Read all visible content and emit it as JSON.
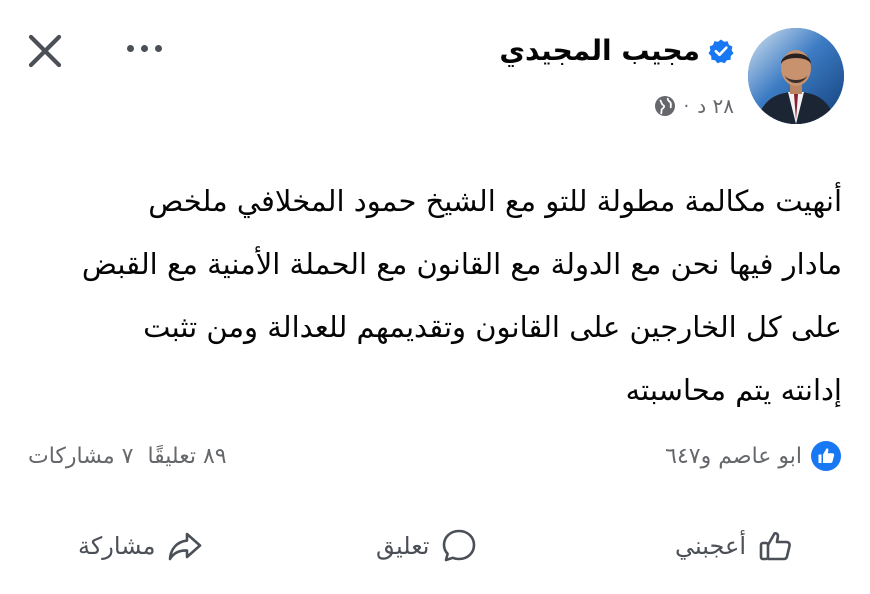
{
  "post": {
    "author_name": "مجيب المجيدي",
    "time": "٢٨ د",
    "separator": "·",
    "lines": [
      "أنهيت مكالمة مطولة للتو مع الشيخ حمود المخلافي ملخص",
      "مادار فيها نحن مع الدولة مع القانون مع الحملة الأمنية مع القبض",
      "على كل الخارجين على القانون وتقديمهم للعدالة  ومن تثبت",
      "إدانته يتم محاسبته"
    ]
  },
  "stats": {
    "reactions": "ابو عاصم و٦٤٧",
    "comments": "٨٩ تعليقًا",
    "shares": "٧ مشاركات"
  },
  "actions": {
    "like": "أعجبني",
    "comment": "تعليق",
    "share": "مشاركة"
  },
  "colors": {
    "text": "#050505",
    "secondary": "#65676b",
    "icon": "#4b4f56",
    "facebook_blue": "#1877f2"
  },
  "icons": [
    "close-icon",
    "more-icon",
    "verified-badge-icon",
    "globe-icon",
    "like-reaction-icon",
    "thumbs-up-icon",
    "comment-icon",
    "share-icon"
  ]
}
